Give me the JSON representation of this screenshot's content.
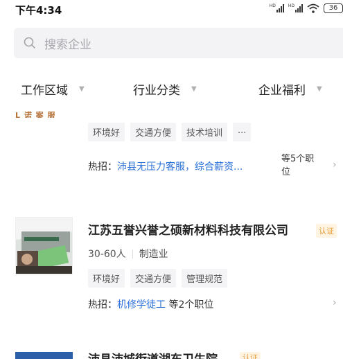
{
  "status_bar": {
    "time": "下午4:34",
    "hd1": "HD",
    "hd2": "HD",
    "battery": "36"
  },
  "search": {
    "placeholder": "搜索企业"
  },
  "filters": [
    {
      "label": "工作区域"
    },
    {
      "label": "行业分类"
    },
    {
      "label": "企业福利"
    }
  ],
  "companies": [
    {
      "logo_text": "L 诺 案 服",
      "tags": [
        "环境好",
        "交通方便",
        "技术培训",
        "..."
      ],
      "hot_prefix": "热招：",
      "hot_jobs": "沛县无压力客服，综合薪资...",
      "more": "等5个职位",
      "more_line1": "等5个职",
      "more_line2": "位"
    },
    {
      "name": "江苏五誉兴誉之硕新材料科技有限公司",
      "badge": "认证",
      "size": "30-60人",
      "industry": "制造业",
      "tags": [
        "环境好",
        "交通方便",
        "管理规范"
      ],
      "hot_prefix": "热招：",
      "hot_jobs": "机修学徒工",
      "more": " 等2个职位"
    },
    {
      "name": "沛县沛城街道湖东卫生院",
      "badge": "认证"
    }
  ]
}
